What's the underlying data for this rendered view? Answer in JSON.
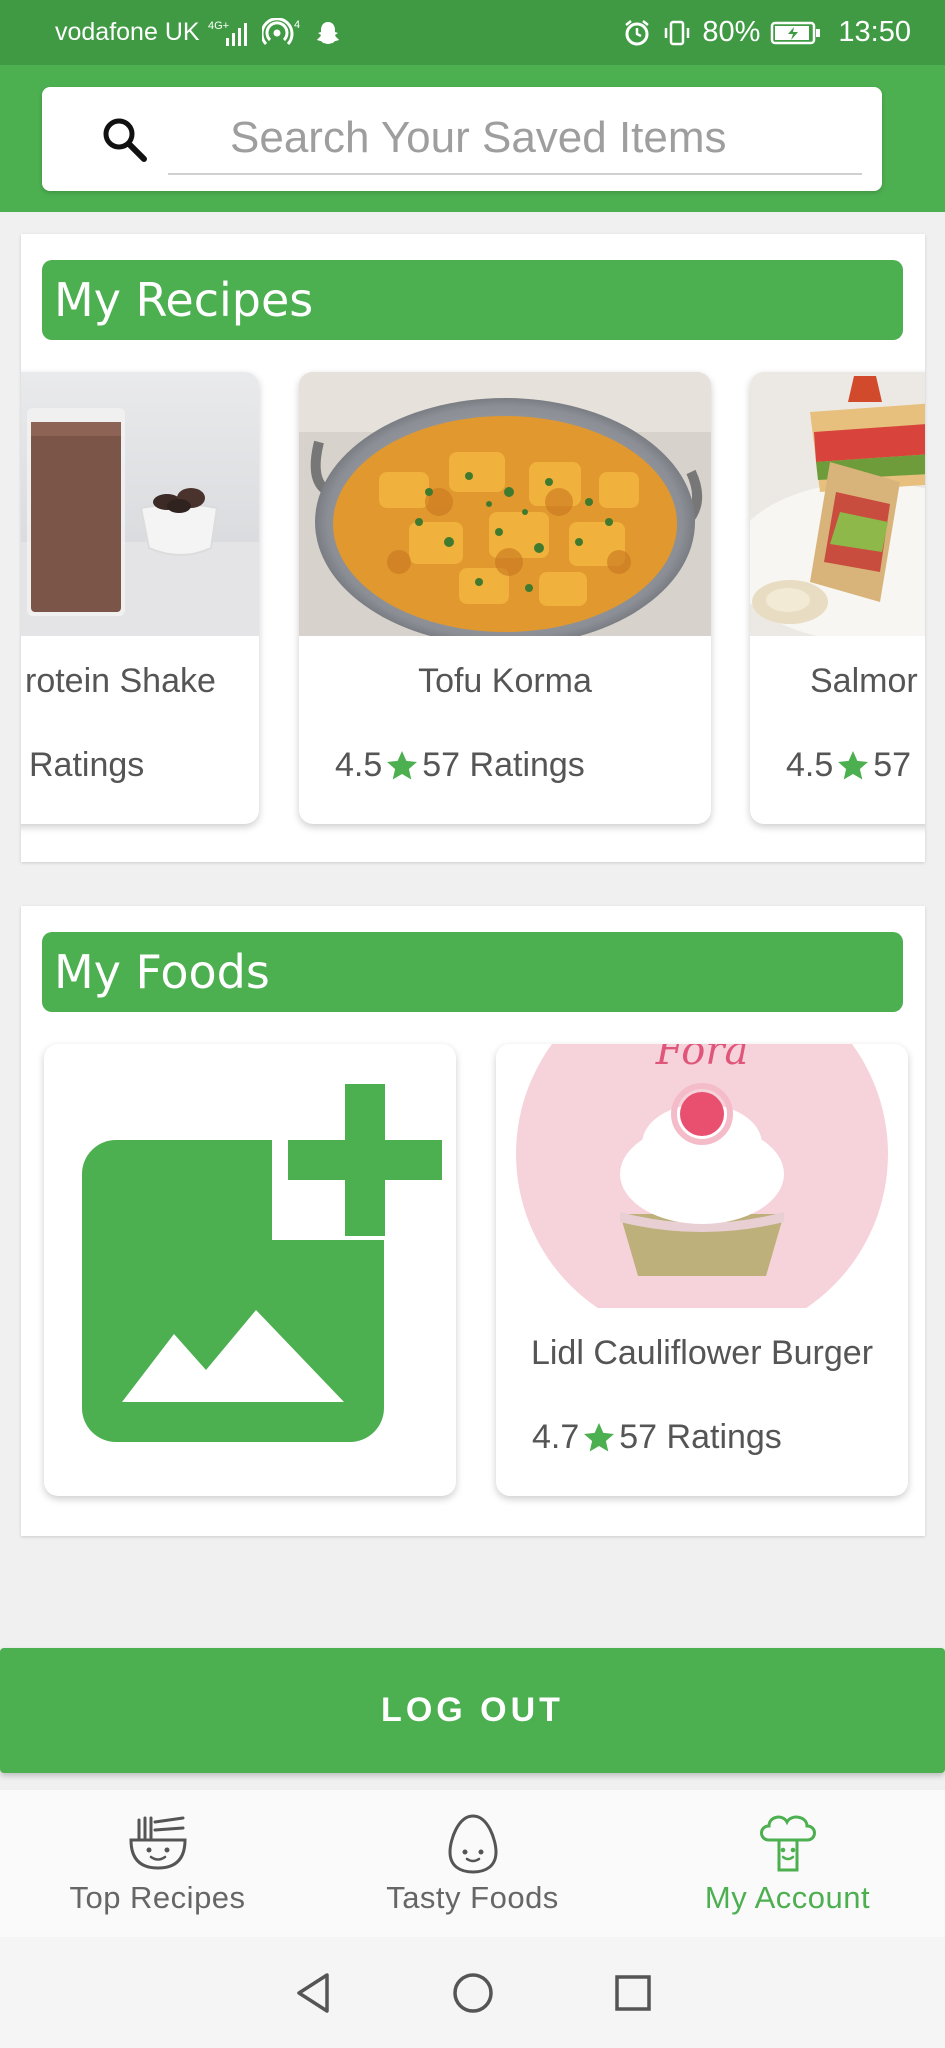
{
  "status_bar": {
    "carrier": "vodafone UK",
    "network": "4G",
    "notification_count": "4",
    "battery": "80%",
    "time": "13:50"
  },
  "search": {
    "placeholder": "Search Your Saved Items"
  },
  "my_recipes": {
    "title": "My Recipes",
    "items": [
      {
        "name": "rotein Shake",
        "rating_text": "Ratings"
      },
      {
        "name": "Tofu Korma",
        "rating": "4.5",
        "rating_text": "57 Ratings"
      },
      {
        "name": "Salmor",
        "rating": "4.5",
        "rating_text": "57"
      }
    ]
  },
  "my_foods": {
    "title": "My Foods",
    "items": [
      {
        "name": "add-food-placeholder"
      },
      {
        "name": "Lidl Cauliflower Burger",
        "rating": "4.7",
        "rating_text": "57 Ratings",
        "image_text": "Fora"
      }
    ]
  },
  "logout_label": "LOG OUT",
  "bottom_nav": [
    {
      "label": "Top Recipes",
      "icon": "bowl-face-icon",
      "active": false
    },
    {
      "label": "Tasty Foods",
      "icon": "egg-face-icon",
      "active": false
    },
    {
      "label": "My Account",
      "icon": "broccoli-face-icon",
      "active": true
    }
  ],
  "colors": {
    "primary": "#4caf50",
    "status_bar": "#3f9a43"
  }
}
